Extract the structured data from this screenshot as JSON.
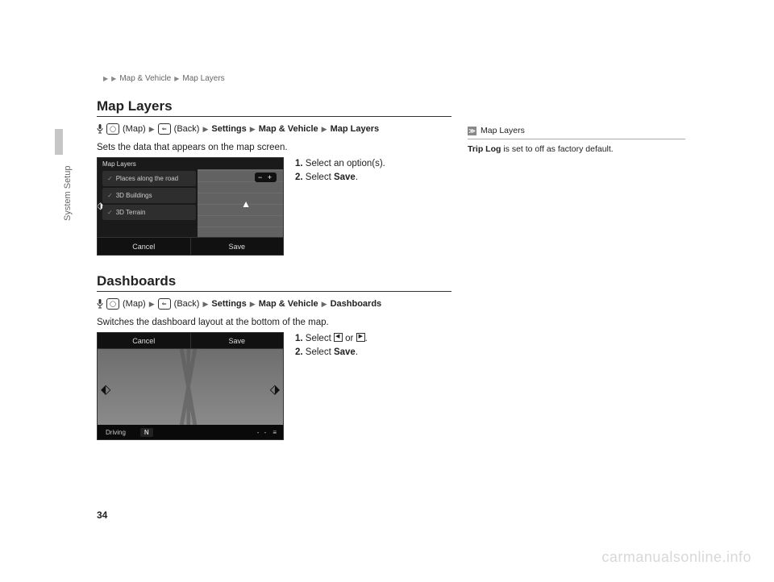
{
  "breadcrumb": {
    "a": "Map & Vehicle",
    "b": "Map Layers"
  },
  "sidetab": "System Setup",
  "section1": {
    "title": "Map Layers",
    "nav": {
      "map": "(Map)",
      "back": "(Back)",
      "p1": "Settings",
      "p2": "Map & Vehicle",
      "p3": "Map Layers"
    },
    "desc": "Sets the data that appears on the map screen.",
    "shot": {
      "title": "Map Layers",
      "items": [
        "Places along the road",
        "3D Buildings",
        "3D Terrain"
      ],
      "zoom": "− +",
      "cancel": "Cancel",
      "save": "Save"
    },
    "steps": {
      "s1n": "1.",
      "s1": "Select an option(s).",
      "s2n": "2.",
      "s2a": "Select ",
      "s2b": "Save",
      "s2c": "."
    }
  },
  "section2": {
    "title": "Dashboards",
    "nav": {
      "map": "(Map)",
      "back": "(Back)",
      "p1": "Settings",
      "p2": "Map & Vehicle",
      "p3": "Dashboards"
    },
    "desc": "Switches the dashboard layout at the bottom of the map.",
    "shot": {
      "cancel": "Cancel",
      "save": "Save",
      "driving": "Driving",
      "N": "N",
      "dots": "- -",
      "menu": "≡"
    },
    "steps": {
      "s1n": "1.",
      "s1a": "Select ",
      "s1b": " or ",
      "s1c": ".",
      "s2n": "2.",
      "s2a": "Select ",
      "s2b": "Save",
      "s2c": "."
    }
  },
  "note": {
    "icon": "≫",
    "head": "Map Layers",
    "body_b": "Trip Log",
    "body_rest": " is set to off as factory default."
  },
  "pageno": "34",
  "watermark": "carmanualsonline.info"
}
